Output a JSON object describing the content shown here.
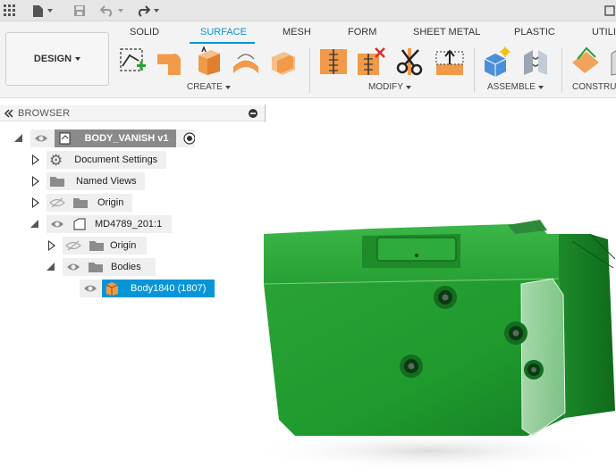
{
  "toolbar": {
    "workspace_label": "DESIGN",
    "tabs": [
      {
        "label": "SOLID"
      },
      {
        "label": "SURFACE"
      },
      {
        "label": "MESH"
      },
      {
        "label": "FORM"
      },
      {
        "label": "SHEET METAL"
      },
      {
        "label": "PLASTIC"
      },
      {
        "label": "UTILI"
      }
    ],
    "active_tab": "SURFACE",
    "groups": {
      "create": "CREATE",
      "modify": "MODIFY",
      "assemble": "ASSEMBLE",
      "construct": "CONSTRU"
    }
  },
  "browser": {
    "title": "BROWSER",
    "tree": {
      "root": "BODY_VANISH v1",
      "document_settings": "Document Settings",
      "named_views": "Named Views",
      "origin": "Origin",
      "component": "MD4789_201:1",
      "component_origin": "Origin",
      "bodies": "Bodies",
      "body": "Body1840 (1807)"
    }
  },
  "colors": {
    "accent": "#0696d7",
    "model_green": "#24952f",
    "tool_orange": "#f09a4a",
    "delete_red": "#e02b2b"
  }
}
